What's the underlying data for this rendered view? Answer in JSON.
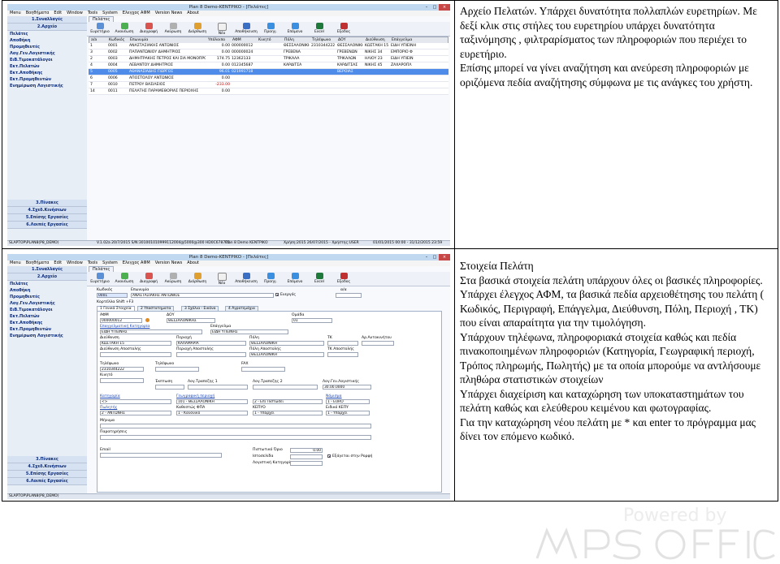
{
  "rows": [
    {
      "text": [
        "Αρχείο Πελατών. Υπάρχει δυνατότητα πολλαπλών ευρετηρίων. Με δεξί κλικ στις στήλες του ευρετηρίου υπάρχει δυνατότητα ταξινόμησης , φιλτραρίσματος των πληροφοριών που περιέχει το ευρετήριο.",
        "Επίσης μπορεί να γίνει αναζήτηση και ανεύρεση πληροφοριών με οριζόμενα πεδία αναζήτησης σύμφωνα με τις ανάγκες του χρήστη."
      ]
    },
    {
      "text": [
        "Στοιχεία Πελάτη",
        "Στα βασικά στοιχεία πελάτη υπάρχουν όλες οι βασικές πληροφορίες. Υπάρχει έλεγχος ΑΦΜ, τα βασικά πεδία αρχειοθέτησης του πελάτη ( Κωδικός, Περιγραφή, Επάγγελμα, Διεύθυνση, Πόλη, Περιοχή , ΤΚ) που είναι απαραίτητα για την τιμολόγηση.",
        "Υπάρχουν τηλέφωνα, πληροφοριακά στοιχεία καθώς και πεδία πινακοποιημένων πληροφοριών (Κατηγορία, Γεωγραφική περιοχή, Τρόπος πληρωμής, Πωλητής) με τα οποία μπορούμε να αντλήσουμε πληθώρα στατιστικών στοιχείων",
        "Υπάρχει διαχείριση και καταχώρηση των υποκαταστημάτων του πελάτη καθώς και ελεύθερου κειμένου και φωτογραφίας.",
        "Για την καταχώρηση νέου πελάτη με * και enter το πρόγραμμα μας δίνει τον επόμενο κωδικό."
      ]
    }
  ],
  "app": {
    "title1": "Plan 8 Demo-ΚΕΝΤΡΙΚΟ - [Πελάτες]",
    "title2": "Plan 8 Demo-ΚΕΝΤΡΙΚΟ - [Πελάτες]",
    "menu": [
      "Menu",
      "Βοηθήματα",
      "Edit",
      "Window",
      "Tools",
      "System",
      "Ελεγχος ΑΦΜ",
      "Version News",
      "About"
    ],
    "left_top": [
      "1.Συναλλαγές",
      "2.Αρχείο"
    ],
    "left_items": [
      "Πελάτες",
      "Αποθήκη",
      "Προμηθευτές",
      "Λογ.Γεν.Λογιστικής",
      "ΕιΒ.Τιμοκατάλογοι",
      "Εκτ.Πελατών",
      "Εκτ.Αποθήκης",
      "Εκτ.Προμηθευτών",
      "Ενημέρωση Λογιστικής"
    ],
    "left_bottom": [
      "3.Πίνακες",
      "4.Σχεδ.Κινήσεων",
      "5.Επίσης Εργασίες",
      "6.Λοιπές Εργασίες"
    ],
    "tab": "Πελάτες",
    "toolbar": [
      "Ευρετήριο",
      "Ανανέωση",
      "Διαγραφή",
      "Ακύρωση",
      "Διόρθωση",
      "Νέο",
      "Αποθήκευση",
      "Προηγ.",
      "Επόμενο",
      "Excel",
      "Εξοδος"
    ],
    "status": [
      "SLAPTOP\\PLAN8(P8_DEMO)",
      "V.1.02a 20/7/2015 S/N:301001010999112004@5000@300 HD0C6787C1",
      "Plan 8 Demo ΚΕΝΤΡΙΚΟ",
      "Χρήση:2015 26/07/2015 - Χρήστης:USER",
      "01/01/2015 00:00 - 31/12/2015 23:59"
    ]
  },
  "grid": {
    "headers": [
      "a/a",
      "Κωδικός",
      "Επωνυμία",
      "Υπόλοιπο",
      "ΑΦΜ",
      "Κινητό",
      "Πόλη",
      "Τηλέφωνο",
      "ΔΟΥ",
      "Διεύθυνση",
      "Επάγγελμα"
    ],
    "rows": [
      [
        "1",
        "0001",
        "ΑΝΑΣΤΑΣΙΑΚΗΣ ΑΝΤΩΝΙΟΣ",
        "0.00",
        "000000012",
        "",
        "ΘΕΣΣΑΛΟΝΙΚΗ",
        "2310344222",
        "ΘΕΣΣΑΛΟΝΙΚΗΣ",
        "ΚΩΣΤΑΚΗ 15",
        "ΕΙΔΗ ΥΠΙΕΙΝΗ"
      ],
      [
        "3",
        "0002",
        "ΠΑΠΑΝΤΩΝΙΟΥ ΔΗΜΗΤΡΙΟΣ",
        "0.00",
        "000000024",
        "",
        "ΓΡΕΒΕΝΑ",
        "",
        "ΓΡΕΒΕΝΩΝ",
        "ΝΙΚΗΣ 34",
        "ΕΜΠΟΡΙΟ Φ"
      ],
      [
        "2",
        "0003",
        "ΔΗΜΗΤΡΑΚΗΣ ΠΕΤΡΟΣ ΚΑΙ ΣΙΑ ΜΟΝΟΠΡΟΣΩ",
        "174.75",
        "12362133",
        "",
        "ΤΡΙΚΑΛΑ",
        "",
        "ΤΡΙΚΑΛΩΝ",
        "ΗΛΙΟΥ 23",
        "ΕΙΔΗ ΥΠΙΕΙΝ"
      ],
      [
        "4",
        "0004",
        "ΛΕΒΑΝΤΟΥ ΔΗΜΗΤΡΙΟΣ",
        "0.00",
        "012345687",
        "",
        "ΚΑΡΔΙΤΣΑ",
        "",
        "ΚΑΡΔΙΤΣΑΣ",
        "ΝΙΚΗΣ 45",
        "ΖΑΧΑΡΟΠΛ"
      ],
      [
        "5",
        "0005",
        "ΑΘΑΝΑΣΙΑΔΗΣ ΓΙΩΡΓΟΣ",
        "96.01",
        "021991718",
        "",
        "",
        "",
        "ΒΕΡΟΙΑΣ",
        "",
        ""
      ],
      [
        "6",
        "0006",
        "ΑΠΟΣΤΟΛΟΥ ΑΝΤΩΝΙΟΣ",
        "0.00",
        "",
        "",
        "",
        "",
        "",
        "",
        ""
      ],
      [
        "7",
        "0010",
        "ΠΕΤΡΟΥ ΒΑΣΙΛΕΙΟΣ",
        "-233.00",
        "",
        "",
        "",
        "",
        "",
        "",
        ""
      ],
      [
        "14",
        "0011",
        "ΠΕΛΑΤΗΣ ΠΑΡΑΜΕΘΟΡΙΑΣ ΠΕΡΙΟΧΗΣ",
        "0.00",
        "",
        "",
        "",
        "",
        "",
        "",
        ""
      ]
    ]
  },
  "form": {
    "code_label": "Κωδικός",
    "name_label": "Επωνυμία",
    "code": "0001",
    "name": "ΑΝΑΣΤΑΣΙΑΚΗΣ ΑΝΤΩΝΙΟΣ",
    "active_label": "Ενεργός",
    "aa_label": "α/α",
    "shortcut": "Κορτέλλα Shift +F3",
    "subtabs": [
      "1 Γενικά Στοιχεία",
      "2 Υπαστατηματα",
      "3 Σχόλια - Εικόνα",
      "4 Αγροτεμάχια"
    ],
    "afm_label": "ΑΦΜ",
    "doy_label": "ΔΟΥ",
    "omada_label": "Ομάδα",
    "afm": "000000012",
    "doy": "ΘΕΣΣΑΛΟΝΙΚΗΣ",
    "omada": "01",
    "ep_link": "Επαγγελματική Κατηγορία",
    "ep_label": "Επάγγελμα",
    "ep_value": "ΕΙΔΗ ΥΓΙΕΙΝΗΣ",
    "ep_value2": "ΕΙΔΗ ΥΓΙΕΙΝΗΣ",
    "addr_label": "Διεύθυνση",
    "area_label": "Περιοχή",
    "city_label": "Πόλη",
    "tk_label": "ΤΚ",
    "ar_label": "Αρ.Αυτοκινήτου",
    "addr": "ΚΩΣΤΑΚΗ 15",
    "area": "ΚΑΛΑΜΑΡΙΑ",
    "city": "ΘΕΣΣΑΛΟΝΙΚΗ",
    "addr2_label": "Διεύθυνση Αποστολής",
    "area2_label": "Περιοχή Αποστολής",
    "city2_label": "Πόλη Αποστολής",
    "tk2_label": "ΤΚ Αποστολής",
    "city2": "ΘΕΣΣΑΛΟΝΙΚΗ",
    "tel_label": "Τηλέφωνο",
    "tel2_label": "Τηλέφωνο",
    "fax_label": "FAX",
    "tel": "2310344222",
    "mobile_label": "Κινητό",
    "ekpt_label": "Έκπτωση",
    "trap_label": "Λογ.Τραπεζης 1",
    "trap2_label": "Λογ.Τραπεζης 2",
    "gl_label": "Λογ.Γεν.Λογιστικής",
    "gl_value": "30.00.0000",
    "cat_link": "Κατηγορία",
    "geo_link": "Γεωγραφική περιοχή",
    "coin_link": "Νόμισμα",
    "cat": "<>",
    "geo": "101 - ΘΕΣΣΑΛΟΝΙΚΗ",
    "etak": "2 - Επί Πιστώσει",
    "coin": "1 - EURO",
    "pay_link": "Πωλητής",
    "fpa_label": "Καθεστώς ΦΠΑ",
    "kep_label": "ΚΕΠΥΟ",
    "tax_label": "Ειδικό ΚΕΠΥ",
    "pay": "2 - ΑΝΤΩΝΗΣ",
    "fpa": "1 - Κανονικό",
    "kep": "1 - Υπάρχει",
    "tax": "1 - Υπάρχει",
    "msg_label": "Μήνυμα",
    "par_label": "Παρατηρήσεις",
    "mail_label": "Email",
    "credit_label": "Πιστωτικό Όριο",
    "site_label": "Ιστοσελίδα",
    "credit_value": "0.00",
    "stats_label": "Εξάγεται στην Poρφή",
    "cat2_label": "Λογιστική Κατηγορία"
  }
}
